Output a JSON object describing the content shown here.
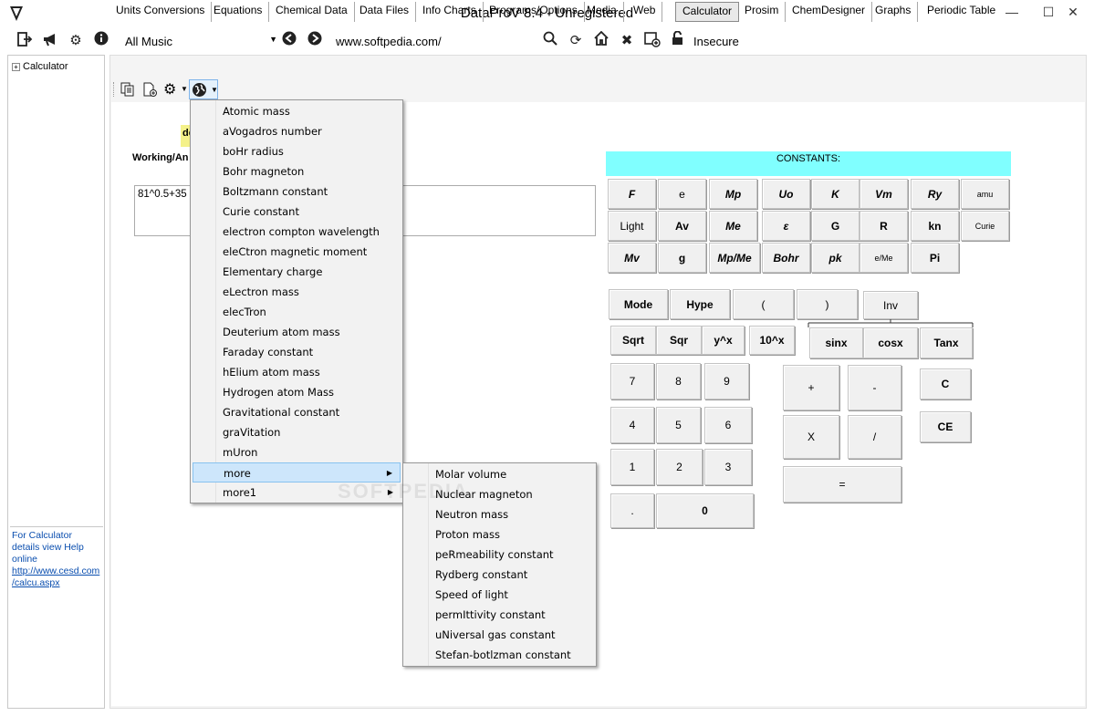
{
  "window": {
    "title": "DataProV 8.4 - Unregistered",
    "minimize": "—",
    "maximize": "☐",
    "close": "✕"
  },
  "toolbar": {
    "music_value": "All Music",
    "url": "www.softpedia.com/",
    "insecure": "Insecure"
  },
  "sidebar": {
    "tree_item": "Calculator",
    "help_text": "For Calculator details view Help online",
    "help_link1": "http://www.cesd.com",
    "help_link2": "/calcu.aspx"
  },
  "tabs": [
    "Units Conversions",
    "Equations",
    "Chemical Data",
    "Data Files",
    "Info Charts",
    "Programs/Options",
    "Media",
    "Web",
    "Calculator",
    "Prosim",
    "ChemDesigner",
    "Graphs",
    "Periodic Table"
  ],
  "main": {
    "label_strip": "de",
    "working_label": "Working/An",
    "expression": "81^0.5+35"
  },
  "calculator": {
    "constants_title": "CONSTANTS:",
    "constants_row1": [
      "F",
      "e",
      "Mp",
      "Uo",
      "K",
      "Vm",
      "Ry",
      "amu"
    ],
    "constants_row2": [
      "Light",
      "Av",
      "Me",
      "ε",
      "G",
      "R",
      "kn",
      "Curie"
    ],
    "constants_row3": [
      "Mv",
      "g",
      "Mp/Me",
      "Bohr",
      "pk",
      "e/Me",
      "Pi"
    ],
    "mode": "Mode",
    "hype": "Hype",
    "lparen": "(",
    "rparen": ")",
    "inv": "Inv",
    "sqrt1": "Sqrt",
    "sqrt2": "Sqr",
    "ypowx": "y^x",
    "tenpowx": "10^x",
    "sinx": "sinx",
    "cosx": "cosx",
    "tanx": "Tanx",
    "d7": "7",
    "d8": "8",
    "d9": "9",
    "d4": "4",
    "d5": "5",
    "d6": "6",
    "d1": "1",
    "d2": "2",
    "d3": "3",
    "dot": ".",
    "d0": "0",
    "plus": "+",
    "minus": "-",
    "times": "X",
    "divide": "/",
    "equals": "=",
    "clear": "C",
    "clear_entry": "CE"
  },
  "menu1": {
    "items": [
      "Atomic mass",
      "aVogadros number",
      "boHr radius",
      "Bohr magneton",
      "Boltzmann constant",
      "Curie constant",
      "electron compton wavelength",
      "eleCtron magnetic moment",
      "Elementary charge",
      "eLectron mass",
      "elecTron",
      "Deuterium atom mass",
      "Faraday constant",
      "hElium atom mass",
      "Hydrogen atom Mass",
      "Gravitational constant",
      "graVitation",
      "mUron",
      "more",
      "more1"
    ]
  },
  "menu2": {
    "items": [
      "Molar volume",
      "Nuclear magneton",
      "Neutron mass",
      "Proton mass",
      "peRmeability constant",
      "Rydberg constant",
      "Speed of light",
      "permIttivity constant",
      "uNiversal gas constant",
      "Stefan-botlzman constant"
    ]
  },
  "watermark": "SOFTPEDIA"
}
